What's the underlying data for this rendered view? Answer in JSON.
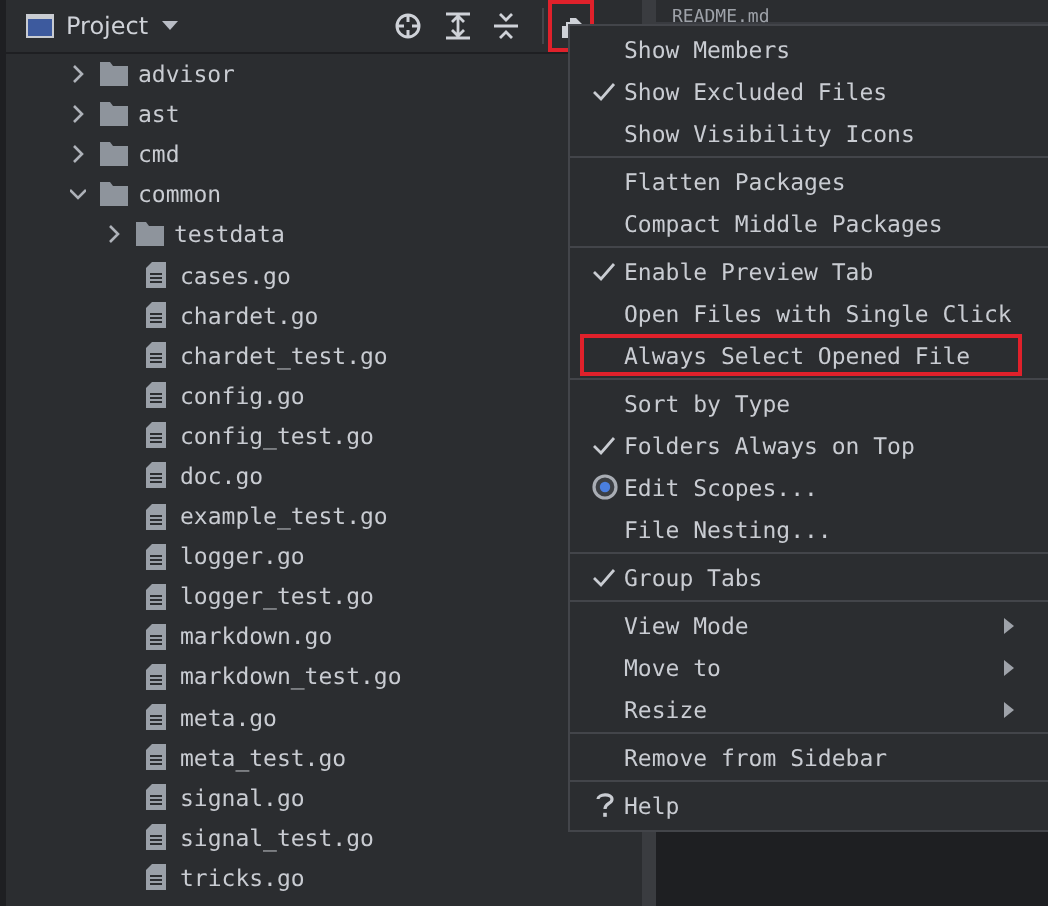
{
  "panel": {
    "title": "Project",
    "options_highlighted": true
  },
  "editor_tab": {
    "label": "README.md"
  },
  "tree": [
    {
      "name": "advisor",
      "kind": "folder",
      "expanded": false
    },
    {
      "name": "ast",
      "kind": "folder",
      "expanded": false
    },
    {
      "name": "cmd",
      "kind": "folder",
      "expanded": false
    },
    {
      "name": "common",
      "kind": "folder",
      "expanded": true,
      "children": [
        {
          "name": "testdata",
          "kind": "folder",
          "expanded": false
        },
        {
          "name": "cases.go",
          "kind": "file"
        },
        {
          "name": "chardet.go",
          "kind": "file"
        },
        {
          "name": "chardet_test.go",
          "kind": "file"
        },
        {
          "name": "config.go",
          "kind": "file"
        },
        {
          "name": "config_test.go",
          "kind": "file"
        },
        {
          "name": "doc.go",
          "kind": "file"
        },
        {
          "name": "example_test.go",
          "kind": "file"
        },
        {
          "name": "logger.go",
          "kind": "file"
        },
        {
          "name": "logger_test.go",
          "kind": "file"
        },
        {
          "name": "markdown.go",
          "kind": "file"
        },
        {
          "name": "markdown_test.go",
          "kind": "file"
        },
        {
          "name": "meta.go",
          "kind": "file"
        },
        {
          "name": "meta_test.go",
          "kind": "file"
        },
        {
          "name": "signal.go",
          "kind": "file"
        },
        {
          "name": "signal_test.go",
          "kind": "file"
        },
        {
          "name": "tricks.go",
          "kind": "file"
        }
      ]
    }
  ],
  "menu": [
    {
      "kind": "item",
      "label": "Show Members",
      "checked": false,
      "submenu": false,
      "highlighted": false
    },
    {
      "kind": "item",
      "label": "Show Excluded Files",
      "checked": true,
      "submenu": false,
      "highlighted": false
    },
    {
      "kind": "item",
      "label": "Show Visibility Icons",
      "checked": false,
      "submenu": false,
      "highlighted": false
    },
    {
      "kind": "separator"
    },
    {
      "kind": "item",
      "label": "Flatten Packages",
      "checked": false,
      "submenu": false,
      "highlighted": false
    },
    {
      "kind": "item",
      "label": "Compact Middle Packages",
      "checked": false,
      "submenu": false,
      "highlighted": false
    },
    {
      "kind": "separator"
    },
    {
      "kind": "item",
      "label": "Enable Preview Tab",
      "checked": true,
      "submenu": false,
      "highlighted": false
    },
    {
      "kind": "item",
      "label": "Open Files with Single Click",
      "checked": false,
      "submenu": false,
      "highlighted": false
    },
    {
      "kind": "item",
      "label": "Always Select Opened File",
      "checked": false,
      "submenu": false,
      "highlighted": true
    },
    {
      "kind": "separator"
    },
    {
      "kind": "item",
      "label": "Sort by Type",
      "checked": false,
      "submenu": false,
      "highlighted": false
    },
    {
      "kind": "item",
      "label": "Folders Always on Top",
      "checked": true,
      "submenu": false,
      "highlighted": false
    },
    {
      "kind": "radio",
      "label": "Edit Scopes...",
      "selected": true,
      "submenu": false,
      "highlighted": false
    },
    {
      "kind": "item",
      "label": "File Nesting...",
      "checked": false,
      "submenu": false,
      "highlighted": false
    },
    {
      "kind": "separator"
    },
    {
      "kind": "item",
      "label": "Group Tabs",
      "checked": true,
      "submenu": false,
      "highlighted": false
    },
    {
      "kind": "separator"
    },
    {
      "kind": "item",
      "label": "View Mode",
      "checked": false,
      "submenu": true,
      "highlighted": false
    },
    {
      "kind": "item",
      "label": "Move to",
      "checked": false,
      "submenu": true,
      "highlighted": false
    },
    {
      "kind": "item",
      "label": "Resize",
      "checked": false,
      "submenu": true,
      "highlighted": false
    },
    {
      "kind": "separator"
    },
    {
      "kind": "item",
      "label": "Remove from Sidebar",
      "checked": false,
      "submenu": false,
      "highlighted": false
    },
    {
      "kind": "separator"
    },
    {
      "kind": "help",
      "label": "Help",
      "submenu": false,
      "highlighted": false
    }
  ]
}
